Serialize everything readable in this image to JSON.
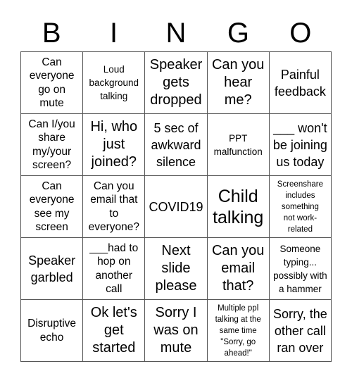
{
  "header": {
    "letters": [
      "B",
      "I",
      "N",
      "G",
      "O"
    ]
  },
  "card": {
    "rows": [
      [
        {
          "text": "Can\neveryone\ngo on\nmute",
          "size": "m"
        },
        {
          "text": "Loud\nbackground\ntalking",
          "size": "s"
        },
        {
          "text": "Speaker\ngets\ndropped",
          "size": "xl"
        },
        {
          "text": "Can you\nhear\nme?",
          "size": "xl"
        },
        {
          "text": "Painful\nfeedback",
          "size": "l"
        }
      ],
      [
        {
          "text": "Can I/you\nshare\nmy/your\nscreen?",
          "size": "m"
        },
        {
          "text": "Hi, who\njust\njoined?",
          "size": "xl"
        },
        {
          "text": "5 sec of\nawkward\nsilence",
          "size": "l"
        },
        {
          "text": "PPT\nmalfunction",
          "size": "s"
        },
        {
          "text": "___ won't\nbe joining\nus today",
          "size": "l"
        }
      ],
      [
        {
          "text": "Can\neveryone\nsee my\nscreen",
          "size": "m"
        },
        {
          "text": "Can you\nemail that\nto\neveryone?",
          "size": "m"
        },
        {
          "text": "COVID19",
          "size": "l"
        },
        {
          "text": "Child\ntalking",
          "size": "xxl"
        },
        {
          "text": "Screenshare\nincludes\nsomething\nnot work-\nrelated",
          "size": "xs"
        }
      ],
      [
        {
          "text": "Speaker\ngarbled",
          "size": "l"
        },
        {
          "text": "___had to\nhop on\nanother\ncall",
          "size": "m"
        },
        {
          "text": "Next\nslide\nplease",
          "size": "xl"
        },
        {
          "text": "Can you\nemail\nthat?",
          "size": "xl"
        },
        {
          "text": "Someone\ntyping...\npossibly with\na hammer",
          "size": "s"
        }
      ],
      [
        {
          "text": "Disruptive\necho",
          "size": "m"
        },
        {
          "text": "Ok let's\nget\nstarted",
          "size": "xl"
        },
        {
          "text": "Sorry I\nwas on\nmute",
          "size": "xl"
        },
        {
          "text": "Multiple ppl\ntalking at the\nsame time\n\"Sorry, go\nahead!\"",
          "size": "xs"
        },
        {
          "text": "Sorry, the\nother call\nran over",
          "size": "l"
        }
      ]
    ]
  }
}
